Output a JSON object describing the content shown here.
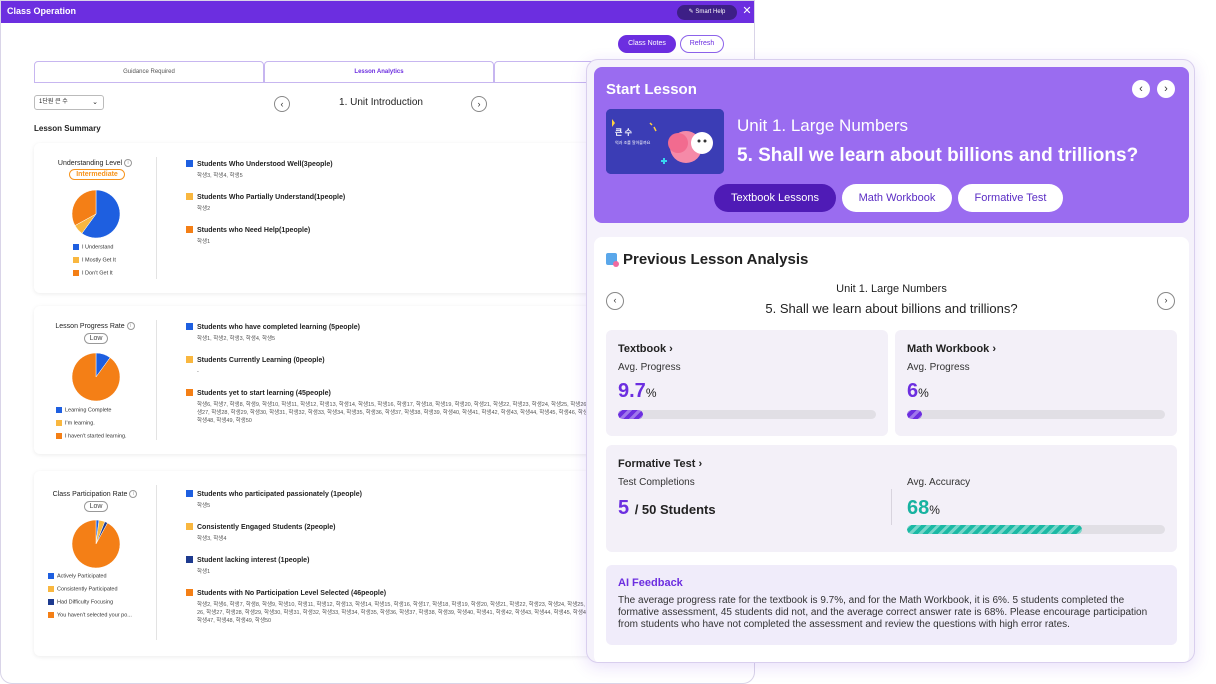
{
  "window": {
    "title": "Class Operation",
    "smart_help": "Smart Help",
    "close": "✕",
    "class_notes": "Class Notes",
    "refresh": "Refresh",
    "tabs": [
      "Guidance Required",
      "Lesson Analytics",
      ""
    ],
    "unit_select": "1단원 큰 수",
    "unit_title": "1. Unit Introduction",
    "summary_heading": "Lesson Summary"
  },
  "colors": {
    "accent": "#6c2ee0",
    "blue": "#1e5fe0",
    "yellow": "#f9b73f",
    "orange": "#f47f16",
    "navy": "#1d3a8f",
    "teal": "#17b2a0"
  },
  "cards": [
    {
      "title": "Understanding Level",
      "badge": "Intermediate",
      "chart_data": {
        "type": "pie",
        "values": [
          60,
          7,
          33
        ],
        "labels": [
          "I Understand",
          "I Mostly Get It",
          "I Don't Get It"
        ],
        "colors": [
          "#1e5fe0",
          "#f9b73f",
          "#f47f16"
        ]
      },
      "groups": [
        {
          "heading": "Students Who Understood Well(3people)",
          "names": "학생3, 학생4, 학생5",
          "color": "#1e5fe0"
        },
        {
          "heading": "Students Who Partially Understand(1people)",
          "names": "학생2",
          "color": "#f9b73f"
        },
        {
          "heading": "Students who Need Help(1people)",
          "names": "학생1",
          "color": "#f47f16"
        }
      ]
    },
    {
      "title": "Lesson Progress Rate",
      "badge": "Low",
      "chart_data": {
        "type": "pie",
        "values": [
          5,
          0,
          45
        ],
        "labels": [
          "Learning Complete",
          "I'm learning.",
          "I haven't started learning."
        ],
        "colors": [
          "#1e5fe0",
          "#f9b73f",
          "#f47f16"
        ]
      },
      "groups": [
        {
          "heading": "Students who have completed learning (5people)",
          "names": "학생1, 학생2, 학생3, 학생4, 학생5",
          "color": "#1e5fe0"
        },
        {
          "heading": "Students Currently Learning (0people)",
          "names": "-",
          "color": "#f9b73f"
        },
        {
          "heading": "Students yet to start learning (45people)",
          "names": "학생6, 학생7, 학생8, 학생9, 학생10, 학생11, 학생12, 학생13, 학생14, 학생15, 학생16, 학생17, 학생18, 학생19, 학생20, 학생21, 학생22, 학생23, 학생24, 학생25, 학생26, 학생27, 학생28, 학생29, 학생30, 학생31, 학생32, 학생33, 학생34, 학생35, 학생36, 학생37, 학생38, 학생39, 학생40, 학생41, 학생42, 학생43, 학생44, 학생45, 학생46, 학생47, 학생48, 학생49, 학생50",
          "color": "#f47f16"
        }
      ]
    },
    {
      "title": "Class Participation Rate",
      "badge": "Low",
      "chart_data": {
        "type": "pie",
        "values": [
          1,
          2,
          1,
          46
        ],
        "labels": [
          "Actively Participated",
          "Consistently Participated",
          "Had Difficulty Focusing",
          "You haven't selected your po..."
        ],
        "colors": [
          "#1e5fe0",
          "#f9b73f",
          "#1d3a8f",
          "#f47f16"
        ]
      },
      "groups": [
        {
          "heading": "Students who participated passionately (1people)",
          "names": "학생5",
          "color": "#1e5fe0"
        },
        {
          "heading": "Consistently Engaged Students (2people)",
          "names": "학생3, 학생4",
          "color": "#f9b73f"
        },
        {
          "heading": "Student lacking interest (1people)",
          "names": "학생1",
          "color": "#1d3a8f"
        },
        {
          "heading": "Students with No Participation Level Selected (46people)",
          "names": "학생2, 학생6, 학생7, 학생8, 학생9, 학생10, 학생11, 학생12, 학생13, 학생14, 학생15, 학생16, 학생17, 학생18, 학생19, 학생20, 학생21, 학생22, 학생23, 학생24, 학생25, 학생26, 학생27, 학생28, 학생29, 학생30, 학생31, 학생32, 학생33, 학생34, 학생35, 학생36, 학생37, 학생38, 학생39, 학생40, 학생41, 학생42, 학생43, 학생44, 학생45, 학생46, 학생47, 학생48, 학생49, 학생50",
          "color": "#f47f16"
        }
      ]
    }
  ],
  "panel": {
    "title": "Start Lesson",
    "prev": "‹",
    "next": "›",
    "thumb_title": "큰 수",
    "thumb_sub": "억과 조를 알아볼까요",
    "unit": "Unit 1. Large Numbers",
    "lesson": "5. Shall we learn about billions and trillions?",
    "buttons": [
      "Textbook Lessons",
      "Math Workbook",
      "Formative Test"
    ],
    "analysis": {
      "title": "Previous Lesson Analysis",
      "unit": "Unit 1. Large Numbers",
      "lesson": "5. Shall we learn about billions and trillions?",
      "textbook": {
        "heading": "Textbook",
        "sub": "Avg. Progress",
        "value": "9.7",
        "unit": "%",
        "progress": 9.7
      },
      "workbook": {
        "heading": "Math Workbook",
        "sub": "Avg. Progress",
        "value": "6",
        "unit": "%",
        "progress": 6
      },
      "formative": {
        "heading": "Formative Test",
        "sub1": "Test Completions",
        "completed": "5",
        "total": "/ 50 Students",
        "sub2": "Avg. Accuracy",
        "accuracy": "68",
        "unit": "%",
        "progress": 68
      },
      "ai": {
        "heading": "AI Feedback",
        "text": "The average progress rate for the textbook is 9.7%, and for the Math Workbook, it is 6%. 5 students completed the formative assessment, 45 students did not, and the average correct answer rate is 68%. Please encourage participation from students who have not completed the assessment and review the questions with high error rates."
      }
    }
  }
}
